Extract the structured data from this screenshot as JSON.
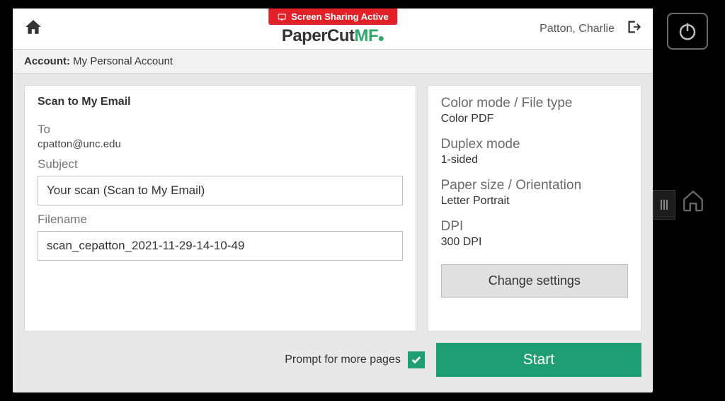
{
  "banner": {
    "text": "Screen Sharing Active"
  },
  "brand": {
    "paper": "Paper",
    "cut": "Cut",
    "mf": "MF"
  },
  "user": {
    "name": "Patton, Charlie"
  },
  "account": {
    "label": "Account:",
    "value": "My Personal Account"
  },
  "scan": {
    "title": "Scan to My Email",
    "to_label": "To",
    "to_value": "cpatton@unc.edu",
    "subject_label": "Subject",
    "subject_value": "Your scan (Scan to My Email)",
    "filename_label": "Filename",
    "filename_value": "scan_cepatton_2021-11-29-14-10-49"
  },
  "settings": {
    "color_label": "Color mode / File type",
    "color_value": "Color PDF",
    "duplex_label": "Duplex mode",
    "duplex_value": "1-sided",
    "paper_label": "Paper size / Orientation",
    "paper_value": "Letter Portrait",
    "dpi_label": "DPI",
    "dpi_value": "300 DPI",
    "change_button": "Change settings"
  },
  "footer": {
    "prompt_label": "Prompt for more pages",
    "start_button": "Start"
  }
}
